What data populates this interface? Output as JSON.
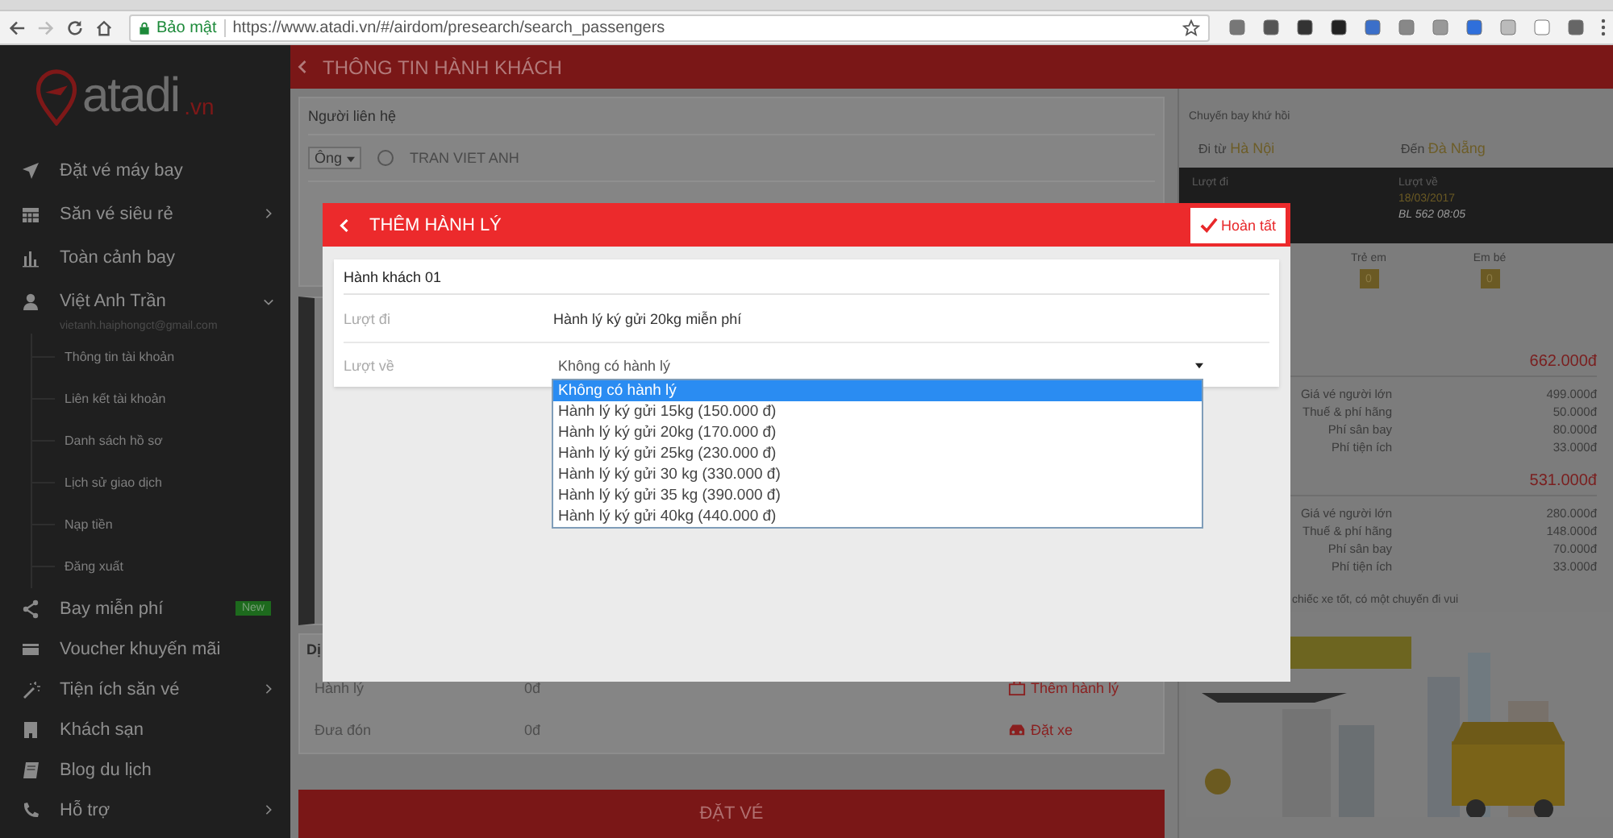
{
  "browser": {
    "security_label": "Bảo mật",
    "url": "https://www.atadi.vn/#/airdom/presearch/search_passengers"
  },
  "sidebar": {
    "logo": {
      "name": "atadi",
      "suffix": ".vn"
    },
    "items": [
      {
        "label": "Đặt vé máy bay"
      },
      {
        "label": "Săn vé siêu rẻ",
        "expanded": false
      },
      {
        "label": "Toàn cảnh bay"
      },
      {
        "label": "Việt Anh Trần",
        "email": "vietanh.haiphongct@gmail.com",
        "expanded": true,
        "children": [
          {
            "label": "Thông tin tài khoản"
          },
          {
            "label": "Liên kết tài khoản"
          },
          {
            "label": "Danh sách hồ sơ"
          },
          {
            "label": "Lịch sử giao dịch"
          },
          {
            "label": "Nạp tiền"
          },
          {
            "label": "Đăng xuất"
          }
        ]
      },
      {
        "label": "Bay miễn phí",
        "badge": "New"
      },
      {
        "label": "Voucher khuyến mãi"
      },
      {
        "label": "Tiện ích săn vé",
        "expanded": false
      },
      {
        "label": "Khách sạn"
      },
      {
        "label": "Blog du lịch"
      },
      {
        "label": "Hỗ trợ",
        "expanded": false
      }
    ]
  },
  "header": {
    "title": "THÔNG TIN HÀNH KHÁCH"
  },
  "contact": {
    "title": "Người liên hệ",
    "salutation": "Ông",
    "checked": false,
    "name": "TRAN VIET ANH"
  },
  "services": {
    "title": "Dị",
    "rows": [
      {
        "label": "Hành lý",
        "value": "0đ",
        "action": "Thêm hành lý"
      },
      {
        "label": "Đưa đón",
        "value": "0đ",
        "action": "Đặt xe"
      }
    ]
  },
  "book_button": "ĐẶT VÉ",
  "trip": {
    "title": "Chuyến bay khứ hồi",
    "from_label": "Đi từ",
    "from": "Hà Nội",
    "to_label": "Đến",
    "to": "Đà Nẵng",
    "legs": [
      {
        "label": "Lượt đi"
      },
      {
        "label": "Lượt về",
        "date": "18/03/2017",
        "flight": "BL 562  08:05"
      }
    ]
  },
  "passengers": [
    {
      "label": "Trẻ em",
      "count": "0"
    },
    {
      "label": "Em bé",
      "count": "0"
    }
  ],
  "fares": [
    {
      "total": "662.000đ",
      "lines": [
        {
          "label": "Giá vé người lớn",
          "value": "499.000đ"
        },
        {
          "label": "Thuế & phí hãng",
          "value": "50.000đ"
        },
        {
          "label": "Phí sân bay",
          "value": "80.000đ"
        },
        {
          "label": "Phí tiện ích",
          "value": "33.000đ"
        }
      ]
    },
    {
      "total": "531.000đ",
      "lines": [
        {
          "label": "Giá vé người lớn",
          "value": "280.000đ"
        },
        {
          "label": "Thuế & phí hãng",
          "value": "148.000đ"
        },
        {
          "label": "Phí sân bay",
          "value": "70.000đ"
        },
        {
          "label": "Phí tiện ích",
          "value": "33.000đ"
        }
      ]
    }
  ],
  "promo_text": "chiếc xe tốt, có một chuyến đi vui",
  "modal": {
    "title": "THÊM HÀNH LÝ",
    "done": "Hoàn tất",
    "passenger": "Hành khách 01",
    "rows": [
      {
        "kind": "text",
        "label": "Lượt đi",
        "value": "Hành lý ký gửi 20kg miễn phí"
      },
      {
        "kind": "select",
        "label": "Lượt về",
        "value": "Không có hành lý"
      }
    ],
    "options": [
      {
        "label": "Không có hành lý",
        "selected": true
      },
      {
        "label": "Hành lý ký gửi 15kg (150.000 đ)",
        "selected": false
      },
      {
        "label": "Hành lý ký gửi 20kg (170.000 đ)",
        "selected": false
      },
      {
        "label": "Hành lý ký gửi 25kg (230.000 đ)",
        "selected": false
      },
      {
        "label": "Hành lý ký gửi 30 kg (330.000 đ)",
        "selected": false
      },
      {
        "label": "Hành lý ký gửi 35 kg (390.000 đ)",
        "selected": false
      },
      {
        "label": "Hành lý ký gửi 40kg (440.000 đ)",
        "selected": false
      }
    ]
  }
}
